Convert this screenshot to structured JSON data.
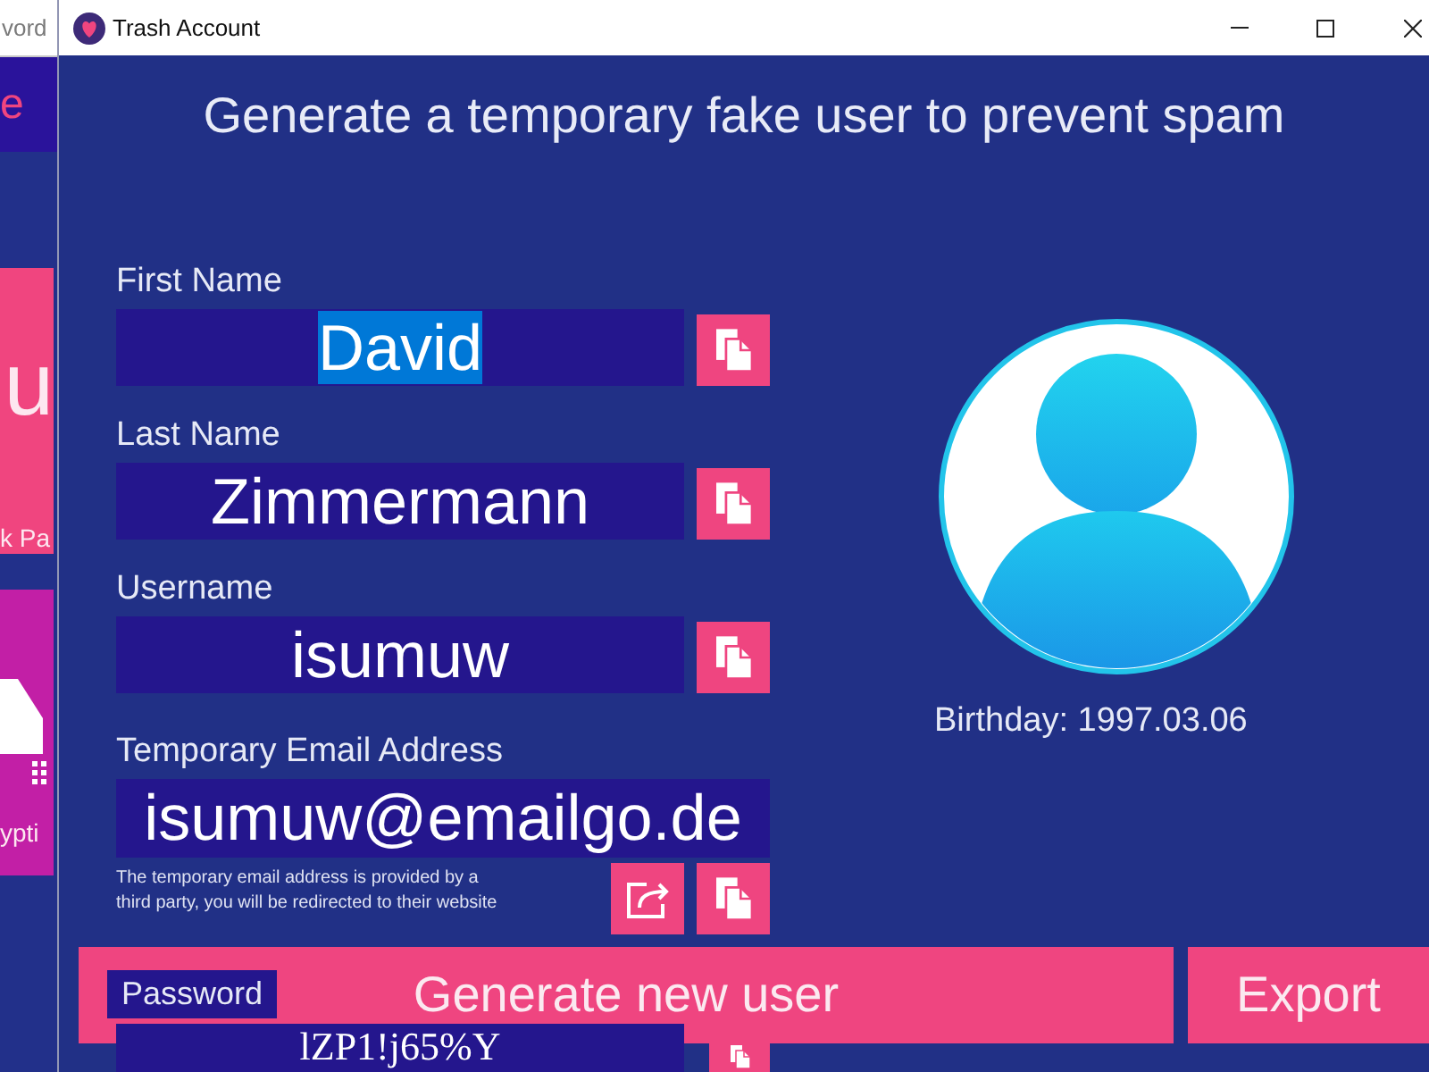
{
  "background_window": {
    "field": {
      "placeholder": "vord"
    },
    "title": "e",
    "tiles": [
      {
        "kind": "text",
        "color": "#f0457f",
        "big_text": "u",
        "caption": "k Pa"
      },
      {
        "kind": "picture",
        "color": "#c21fa6",
        "caption": "ypti"
      }
    ]
  },
  "window": {
    "title": "Trash Account"
  },
  "heading": "Generate a temporary fake user to prevent spam",
  "fields": [
    {
      "kind": "inline",
      "label": "First Name",
      "value": "David",
      "text_selected": true,
      "actions": [
        {
          "kind": "copy"
        }
      ]
    },
    {
      "kind": "inline",
      "label": "Last Name",
      "value": "Zimmermann",
      "text_selected": false,
      "actions": [
        {
          "kind": "copy"
        }
      ]
    },
    {
      "kind": "inline",
      "label": "Username",
      "value": "isumuw",
      "text_selected": false,
      "actions": [
        {
          "kind": "copy"
        }
      ]
    },
    {
      "kind": "stacked",
      "label": "Temporary Email Address",
      "value": "isumuw@emailgo.de",
      "text_selected": false,
      "note": "The temporary email address is provided by a\nthird party, you will be redirected to their website",
      "actions": [
        {
          "kind": "open"
        },
        {
          "kind": "copy"
        }
      ]
    }
  ],
  "password": {
    "label": "Password",
    "value": "lZP1!j65%Y",
    "actions": [
      {
        "kind": "copy"
      }
    ]
  },
  "profile": {
    "birthday": "Birthday: 1997.03.06"
  },
  "buttons": [
    {
      "label": "Generate new user"
    },
    {
      "label": "Export"
    }
  ]
}
